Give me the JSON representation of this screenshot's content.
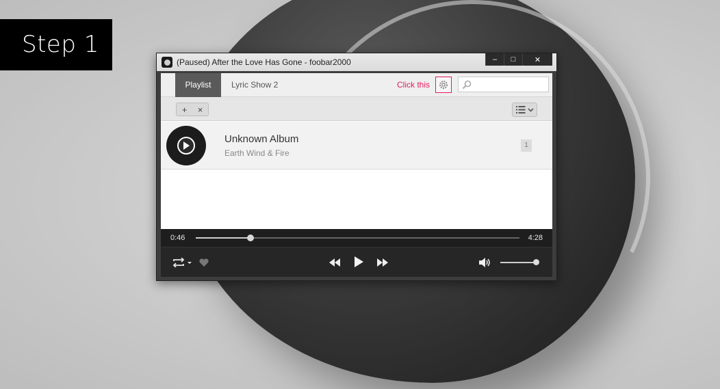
{
  "step_label": "Step 1",
  "window": {
    "title": "(Paused) After the Love Has Gone - foobar2000",
    "buttons": {
      "minimize": "‒",
      "maximize": "□",
      "close": "✕"
    }
  },
  "tabs": [
    {
      "label": "Playlist",
      "active": true
    },
    {
      "label": "Lyric Show 2",
      "active": false
    }
  ],
  "hint": {
    "text": "Click this",
    "color": "#e21b5b"
  },
  "search": {
    "placeholder": "",
    "icon": "search-icon"
  },
  "toolbar": {
    "add_label": "+",
    "remove_label": "×",
    "view_icon": "list-view-icon"
  },
  "album": {
    "title": "Unknown Album",
    "artist": "Earth Wind & Fire",
    "track_count": "1"
  },
  "seek": {
    "current": "0:46",
    "total": "4:28",
    "progress": 0.17
  },
  "controls": {
    "repeat_icon": "repeat-icon",
    "favorite_icon": "heart-icon",
    "prev_icon": "rewind-icon",
    "play_icon": "play-icon",
    "next_icon": "fast-forward-icon",
    "volume_icon": "speaker-icon",
    "volume": 0.92
  }
}
